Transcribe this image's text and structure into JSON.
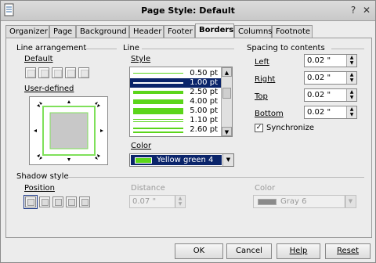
{
  "window": {
    "title": "Page Style: Default"
  },
  "tabs": [
    "Organizer",
    "Page",
    "Background",
    "Header",
    "Footer",
    "Borders",
    "Columns",
    "Footnote"
  ],
  "line_arrangement": {
    "section": "Line arrangement",
    "default_label": "Default",
    "user_defined_label": "User-defined"
  },
  "line": {
    "section": "Line",
    "style_label": "Style",
    "styles": [
      "0.50 pt",
      "1.00 pt",
      "2.50 pt",
      "4.00 pt",
      "5.00 pt",
      "1.10 pt",
      "2.60 pt"
    ],
    "selected_style": "1.00 pt",
    "color_label": "Color",
    "color_value": "Yellow green 4",
    "color_hex": "#5bd51a"
  },
  "spacing": {
    "section": "Spacing to contents",
    "left_label": "Left",
    "left_value": "0.02 \"",
    "right_label": "Right",
    "right_value": "0.02 \"",
    "top_label": "Top",
    "top_value": "0.02 \"",
    "bottom_label": "Bottom",
    "bottom_value": "0.02 \"",
    "sync_label": "Synchronize",
    "sync_checked": true
  },
  "shadow": {
    "section": "Shadow style",
    "position_label": "Position",
    "distance_label": "Distance",
    "distance_value": "0.07 \"",
    "color_label": "Color",
    "color_value": "Gray 6"
  },
  "buttons": {
    "ok": "OK",
    "cancel": "Cancel",
    "help": "Help",
    "reset": "Reset"
  }
}
